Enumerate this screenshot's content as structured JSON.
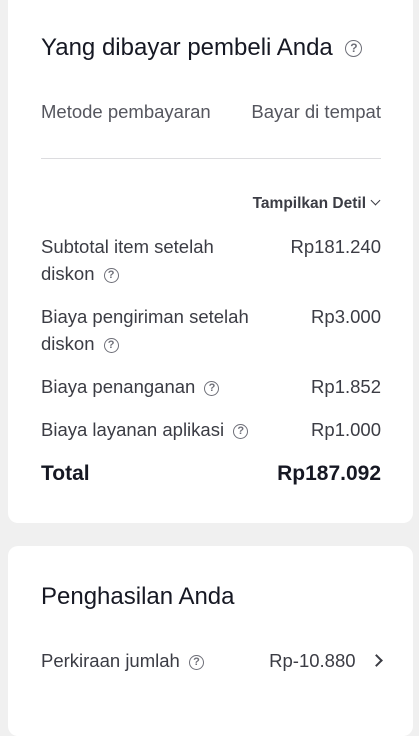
{
  "buyer_paid": {
    "title": "Yang dibayar pembeli Anda",
    "payment_method_label": "Metode pembayaran",
    "payment_method_value": "Bayar di tempat",
    "show_details_label": "Tampilkan Detil",
    "rows": [
      {
        "label_line1": "Subtotal item setelah",
        "label_line2": "diskon",
        "value": "Rp181.240"
      },
      {
        "label_line1": "Biaya pengiriman setelah",
        "label_line2": "diskon",
        "value": "Rp3.000"
      },
      {
        "label": "Biaya penanganan",
        "value": "Rp1.852"
      },
      {
        "label": "Biaya layanan aplikasi",
        "value": "Rp1.000"
      }
    ],
    "total_label": "Total",
    "total_value": "Rp187.092"
  },
  "earnings": {
    "title": "Penghasilan Anda",
    "estimate_label": "Perkiraan jumlah",
    "estimate_value": "Rp-10.880"
  },
  "icons": {
    "help": "help-circle-icon",
    "chevron_down": "chevron-down-icon",
    "chevron_right": "chevron-right-icon"
  },
  "help_glyph": "?"
}
